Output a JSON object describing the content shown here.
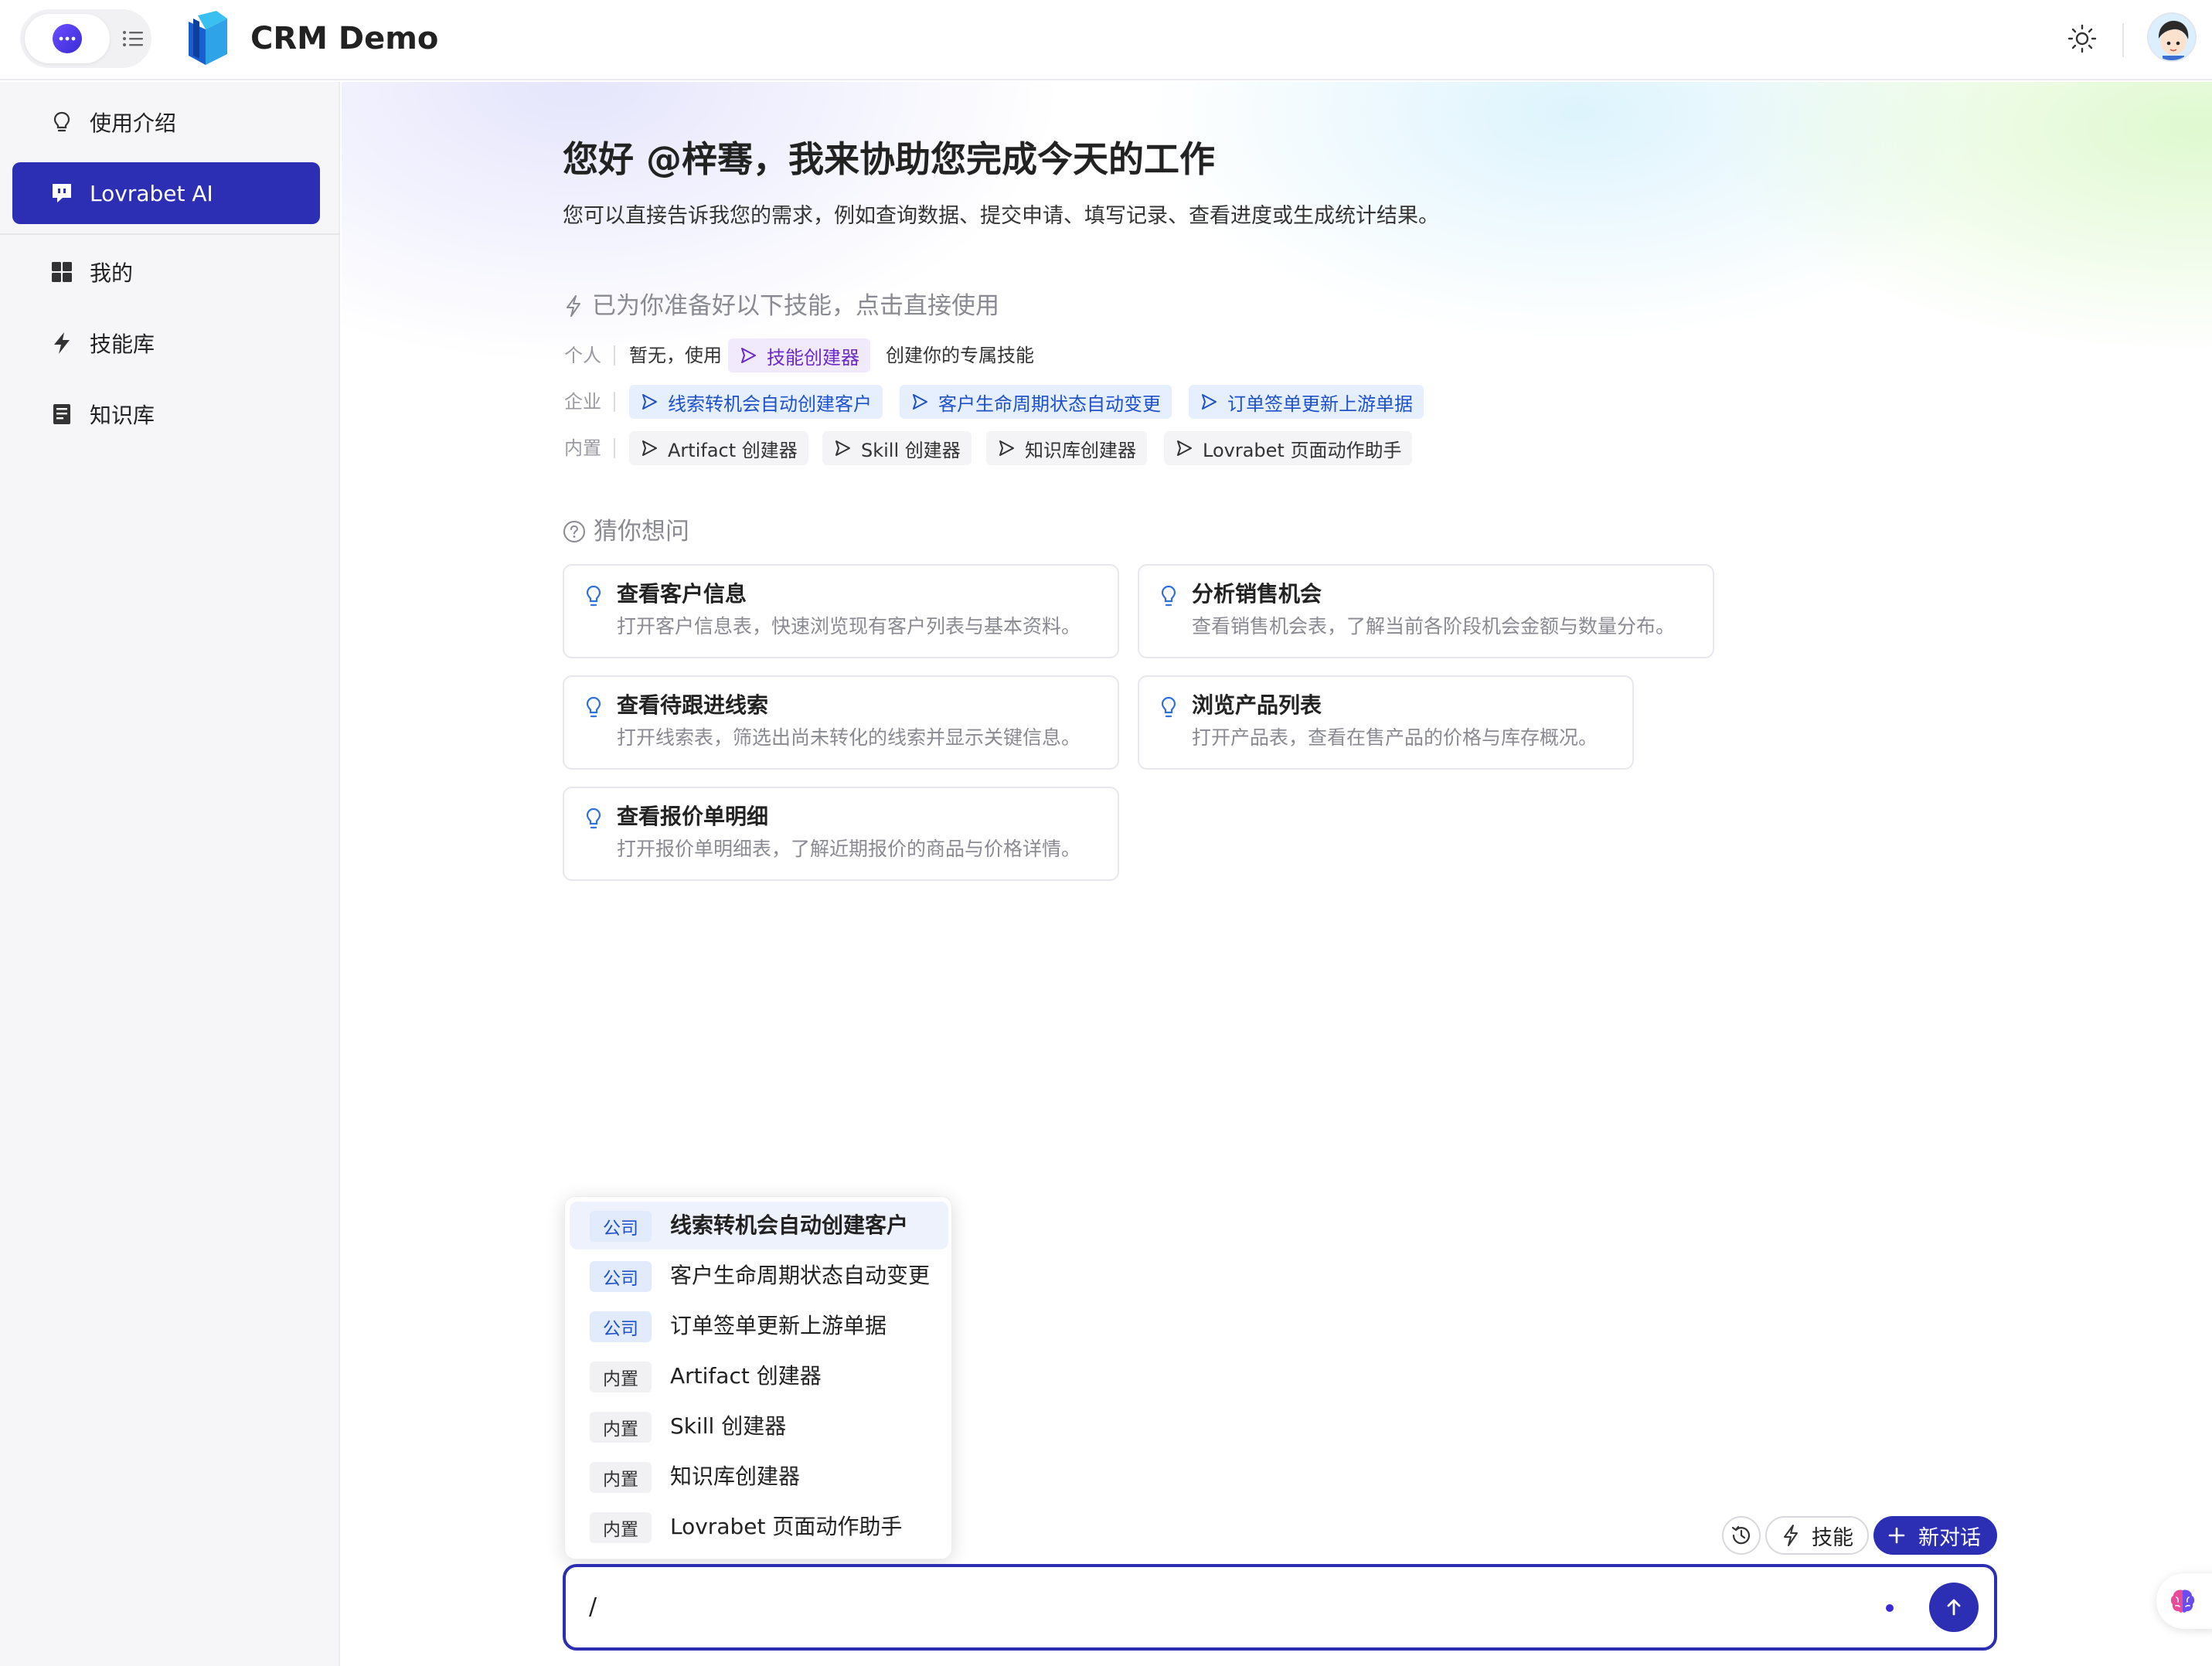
{
  "app": {
    "title": "CRM Demo"
  },
  "sidebar": {
    "items": [
      {
        "label": "使用介绍",
        "icon": "lightbulb-icon"
      },
      {
        "label": "Lovrabet AI",
        "icon": "chat-bot-icon",
        "active": true
      },
      {
        "label": "我的",
        "icon": "grid-icon"
      },
      {
        "label": "技能库",
        "icon": "lightning-icon"
      },
      {
        "label": "知识库",
        "icon": "notebook-icon"
      }
    ]
  },
  "main": {
    "greeting": "您好 @梓骞，我来协助您完成今天的工作",
    "subtitle": "您可以直接告诉我您的需求，例如查询数据、提交申请、填写记录、查看进度或生成统计结果。",
    "skills_heading": "已为你准备好以下技能，点击直接使用",
    "skills": {
      "personal": {
        "label": "个人",
        "prefix": "暂无，使用",
        "chip": "技能创建器",
        "suffix": "创建你的专属技能"
      },
      "enterprise": {
        "label": "企业",
        "chips": [
          "线索转机会自动创建客户",
          "客户生命周期状态自动变更",
          "订单签单更新上游单据"
        ]
      },
      "builtin": {
        "label": "内置",
        "chips": [
          "Artifact 创建器",
          "Skill 创建器",
          "知识库创建器",
          "Lovrabet 页面动作助手"
        ]
      }
    },
    "suggest_heading": "猜你想问",
    "cards": [
      {
        "title": "查看客户信息",
        "desc": "打开客户信息表，快速浏览现有客户列表与基本资料。"
      },
      {
        "title": "分析销售机会",
        "desc": "查看销售机会表，了解当前各阶段机会金额与数量分布。"
      },
      {
        "title": "查看待跟进线索",
        "desc": "打开线索表，筛选出尚未转化的线索并显示关键信息。"
      },
      {
        "title": "浏览产品列表",
        "desc": "打开产品表，查看在售产品的价格与库存概况。"
      },
      {
        "title": "查看报价单明细",
        "desc": "打开报价单明细表，了解近期报价的商品与价格详情。"
      }
    ]
  },
  "dropdown": {
    "items": [
      {
        "tag": "公司",
        "label": "线索转机会自动创建客户",
        "highlighted": true
      },
      {
        "tag": "公司",
        "label": "客户生命周期状态自动变更"
      },
      {
        "tag": "公司",
        "label": "订单签单更新上游单据"
      },
      {
        "tag": "内置",
        "label": "Artifact 创建器"
      },
      {
        "tag": "内置",
        "label": "Skill 创建器"
      },
      {
        "tag": "内置",
        "label": "知识库创建器"
      },
      {
        "tag": "内置",
        "label": "Lovrabet 页面动作助手"
      }
    ]
  },
  "composer": {
    "history_icon": "history-icon",
    "skill_label": "技能",
    "new_chat_label": "新对话",
    "input_value": "/"
  },
  "colors": {
    "accent": "#2c2fb4",
    "chip_blue": "#1f51c9",
    "chip_purple": "#6a2bc8"
  }
}
